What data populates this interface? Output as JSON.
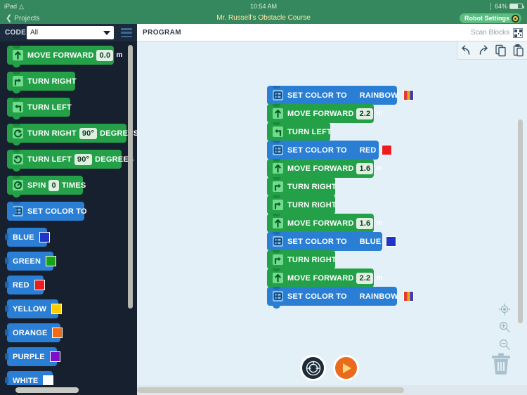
{
  "status_bar": {
    "device": "iPad",
    "wifi_icon": "wifi-icon",
    "time": "10:54 AM",
    "bluetooth_icon": "bluetooth-icon",
    "battery_text": "64%"
  },
  "nav": {
    "back_label": "Projects",
    "back_icon": "chevron-left-icon",
    "title": "Mr. Russell's Obstacle Course",
    "robot_settings_label": "Robot Settings",
    "robot_settings_icon": "gear-icon"
  },
  "toolbar": {
    "code_label": "CODE",
    "filter_value": "All",
    "filter_caret_icon": "chevron-down-icon",
    "menu_icon": "hamburger-menu-icon",
    "program_label": "PROGRAM",
    "scan_blocks_label": "Scan Blocks",
    "scan_icon": "qr-scan-icon"
  },
  "canvas_toolbar": {
    "undo_icon": "undo-icon",
    "redo_icon": "redo-icon",
    "copy_icon": "copy-icon",
    "paste_icon": "paste-icon"
  },
  "zoom_controls": {
    "center_icon": "crosshair-target-icon",
    "zoom_in_icon": "zoom-in-icon",
    "zoom_out_icon": "zoom-out-icon"
  },
  "canvas_actions": {
    "trash_icon": "trash-icon",
    "drive_label": "drive-button",
    "drive_icon": "steering-wheel-icon",
    "play_label": "run-program-button",
    "play_icon": "play-icon"
  },
  "palette": {
    "blocks": [
      {
        "id": "move-forward",
        "kind": "motion",
        "icon": "arrow-up-icon",
        "label": "MOVE FORWARD",
        "value": "0.0",
        "unit": "m",
        "width": 152
      },
      {
        "id": "turn-right",
        "kind": "motion",
        "icon": "arrow-turn-right-icon",
        "label": "TURN RIGHT",
        "width": 97
      },
      {
        "id": "turn-left",
        "kind": "motion",
        "icon": "arrow-turn-left-icon",
        "label": "TURN LEFT",
        "width": 90
      },
      {
        "id": "turn-right-degrees",
        "kind": "motion",
        "icon": "rotate-right-icon",
        "label": "TURN RIGHT",
        "value": "90°",
        "suffix": "DEGREES",
        "width": 170
      },
      {
        "id": "turn-left-degrees",
        "kind": "motion",
        "icon": "rotate-left-icon",
        "label": "TURN LEFT",
        "value": "90°",
        "suffix": "DEGREES",
        "width": 163
      },
      {
        "id": "spin-times",
        "kind": "motion",
        "icon": "spin-icon",
        "label": "SPIN",
        "value": "0",
        "suffix": "TIMES",
        "width": 108
      },
      {
        "id": "set-color-to",
        "kind": "light",
        "icon": "light-panel-icon",
        "label": "SET COLOR TO",
        "width": 110
      },
      {
        "id": "color-blue",
        "kind": "value",
        "label": "BLUE",
        "swatch": "#1f35c9",
        "width": 57
      },
      {
        "id": "color-green",
        "kind": "value",
        "label": "GREEN",
        "swatch": "#16a316",
        "width": 66
      },
      {
        "id": "color-red",
        "kind": "value",
        "label": "RED",
        "swatch": "#ee1c1c",
        "width": 52
      },
      {
        "id": "color-yellow",
        "kind": "value",
        "label": "YELLOW",
        "swatch": "#ffcc00",
        "width": 73
      },
      {
        "id": "color-orange",
        "kind": "value",
        "label": "ORANGE",
        "swatch": "#f26a11",
        "width": 76
      },
      {
        "id": "color-purple",
        "kind": "value",
        "label": "PURPLE",
        "swatch": "#7d11c9",
        "width": 71
      },
      {
        "id": "color-white",
        "kind": "value",
        "label": "WHITE",
        "swatch": "#ffffff",
        "width": 65
      }
    ]
  },
  "program": {
    "blocks": [
      {
        "id": "p1",
        "kind": "light",
        "icon": "light-panel-icon",
        "label": "SET COLOR TO",
        "arg_label": "RAINBOW",
        "swatch": "rainbow",
        "width": 185
      },
      {
        "id": "p2",
        "kind": "motion",
        "icon": "arrow-up-icon",
        "label": "MOVE FORWARD",
        "value": "2.2",
        "unit": "m",
        "width": 152
      },
      {
        "id": "p3",
        "kind": "motion",
        "icon": "arrow-turn-left-icon",
        "label": "TURN LEFT",
        "width": 90
      },
      {
        "id": "p4",
        "kind": "light",
        "icon": "light-panel-icon",
        "label": "SET COLOR TO",
        "arg_label": "RED",
        "swatch": "#ee1c1c",
        "width": 159
      },
      {
        "id": "p5",
        "kind": "motion",
        "icon": "arrow-up-icon",
        "label": "MOVE FORWARD",
        "value": "1.6",
        "unit": "m",
        "width": 152
      },
      {
        "id": "p6",
        "kind": "motion",
        "icon": "arrow-turn-right-icon",
        "label": "TURN RIGHT",
        "width": 97
      },
      {
        "id": "p7",
        "kind": "motion",
        "icon": "arrow-turn-right-icon",
        "label": "TURN RIGHT",
        "width": 97
      },
      {
        "id": "p8",
        "kind": "motion",
        "icon": "arrow-up-icon",
        "label": "MOVE FORWARD",
        "value": "1.6",
        "unit": "m",
        "width": 152
      },
      {
        "id": "p9",
        "kind": "light",
        "icon": "light-panel-icon",
        "label": "SET COLOR TO",
        "arg_label": "BLUE",
        "swatch": "#1f35c9",
        "width": 164
      },
      {
        "id": "p10",
        "kind": "motion",
        "icon": "arrow-turn-right-icon",
        "label": "TURN RIGHT",
        "width": 97
      },
      {
        "id": "p11",
        "kind": "motion",
        "icon": "arrow-up-icon",
        "label": "MOVE FORWARD",
        "value": "2.2",
        "unit": "m",
        "width": 152
      },
      {
        "id": "p12",
        "kind": "light",
        "icon": "light-panel-icon",
        "label": "SET COLOR TO",
        "arg_label": "RAINBOW",
        "swatch": "rainbow",
        "width": 185
      }
    ]
  },
  "colors": {
    "nav_green": "#35875d",
    "palette_bg": "#16202e",
    "canvas_bg": "#e3f0f7",
    "motion_green": "#24a148",
    "light_blue": "#2a7fd4",
    "accent_orange": "#ea6a1e",
    "title_yellow": "#ffe9a8"
  }
}
